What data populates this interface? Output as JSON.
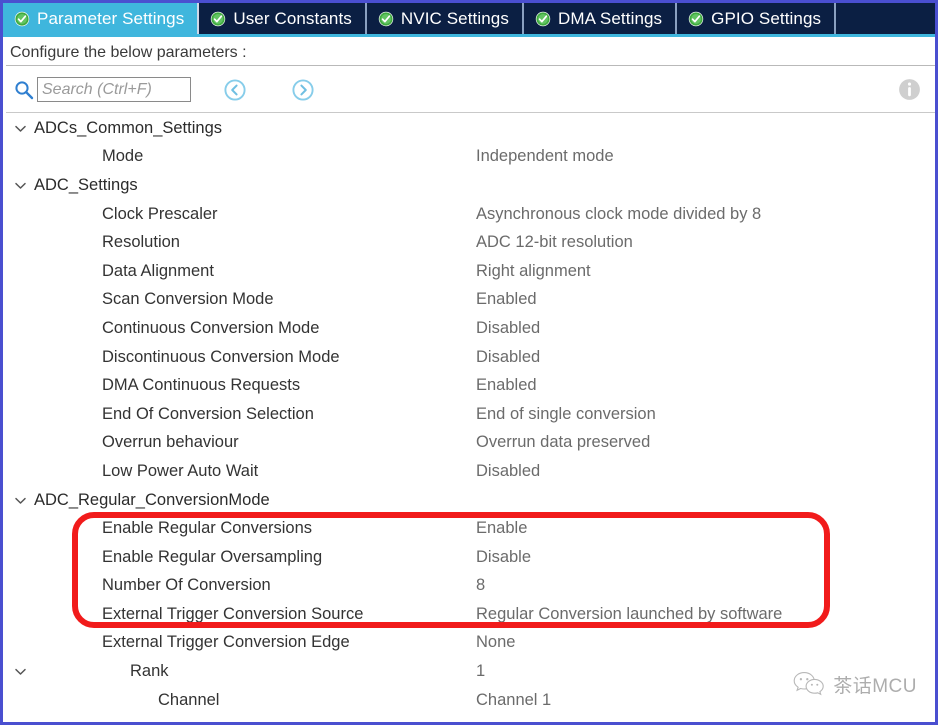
{
  "window": {
    "frame_color": "#4a4fd0"
  },
  "tabs": {
    "active_index": 0,
    "check_icon": "check-circle-icon",
    "active_bg": "#3fb6dd",
    "inactive_bg": "#0b1f43",
    "items": [
      {
        "label": "Parameter Settings"
      },
      {
        "label": "User Constants"
      },
      {
        "label": "NVIC Settings"
      },
      {
        "label": "DMA Settings"
      },
      {
        "label": "GPIO Settings"
      }
    ]
  },
  "subheader": {
    "text": "Configure the below parameters :"
  },
  "search": {
    "icon": "search-icon",
    "value": "",
    "placeholder": "Search (Ctrl+F)",
    "prev_icon": "chevron-left-circle-icon",
    "next_icon": "chevron-right-circle-icon",
    "info_icon": "info-circle-icon",
    "accent": "#5cb8e6"
  },
  "tree": {
    "rows": [
      {
        "label": "ADCs_Common_Settings",
        "value": "",
        "indent": 0,
        "chevron": true,
        "group": true
      },
      {
        "label": "Mode",
        "value": "Independent mode",
        "indent": 1,
        "chevron": false,
        "group": false
      },
      {
        "label": "ADC_Settings",
        "value": "",
        "indent": 0,
        "chevron": true,
        "group": true
      },
      {
        "label": "Clock Prescaler",
        "value": "Asynchronous clock mode divided by 8",
        "indent": 1,
        "chevron": false,
        "group": false
      },
      {
        "label": "Resolution",
        "value": "ADC 12-bit resolution",
        "indent": 1,
        "chevron": false,
        "group": false
      },
      {
        "label": "Data Alignment",
        "value": "Right alignment",
        "indent": 1,
        "chevron": false,
        "group": false
      },
      {
        "label": "Scan Conversion Mode",
        "value": "Enabled",
        "indent": 1,
        "chevron": false,
        "group": false
      },
      {
        "label": "Continuous Conversion Mode",
        "value": "Disabled",
        "indent": 1,
        "chevron": false,
        "group": false
      },
      {
        "label": "Discontinuous Conversion Mode",
        "value": "Disabled",
        "indent": 1,
        "chevron": false,
        "group": false
      },
      {
        "label": "DMA Continuous Requests",
        "value": "Enabled",
        "indent": 1,
        "chevron": false,
        "group": false
      },
      {
        "label": "End Of Conversion Selection",
        "value": "End of single conversion",
        "indent": 1,
        "chevron": false,
        "group": false
      },
      {
        "label": "Overrun behaviour",
        "value": "Overrun data preserved",
        "indent": 1,
        "chevron": false,
        "group": false
      },
      {
        "label": "Low Power Auto Wait",
        "value": "Disabled",
        "indent": 1,
        "chevron": false,
        "group": false
      },
      {
        "label": "ADC_Regular_ConversionMode",
        "value": "",
        "indent": 0,
        "chevron": true,
        "group": true
      },
      {
        "label": "Enable Regular Conversions",
        "value": "Enable",
        "indent": 1,
        "chevron": false,
        "group": false
      },
      {
        "label": "Enable Regular Oversampling",
        "value": "Disable",
        "indent": 1,
        "chevron": false,
        "group": false
      },
      {
        "label": "Number Of Conversion",
        "value": "8",
        "indent": 1,
        "chevron": false,
        "group": false
      },
      {
        "label": "External Trigger Conversion Source",
        "value": "Regular Conversion launched by software",
        "indent": 1,
        "chevron": false,
        "group": false
      },
      {
        "label": "External Trigger Conversion Edge",
        "value": "None",
        "indent": 1,
        "chevron": false,
        "group": false
      },
      {
        "label": "Rank",
        "value": "1",
        "indent": 2,
        "chevron": true,
        "group": false
      },
      {
        "label": "Channel",
        "value": "Channel 1",
        "indent": 3,
        "chevron": false,
        "group": false
      }
    ]
  },
  "annotation": {
    "type": "red-rounded-rectangle",
    "color": "#f11b1b",
    "highlighted_rows": [
      "Enable Regular Conversions",
      "Enable Regular Oversampling",
      "Number Of Conversion",
      "External Trigger Conversion Source"
    ]
  },
  "watermark": {
    "logo": "wechat-logo",
    "text": "茶话MCU"
  }
}
